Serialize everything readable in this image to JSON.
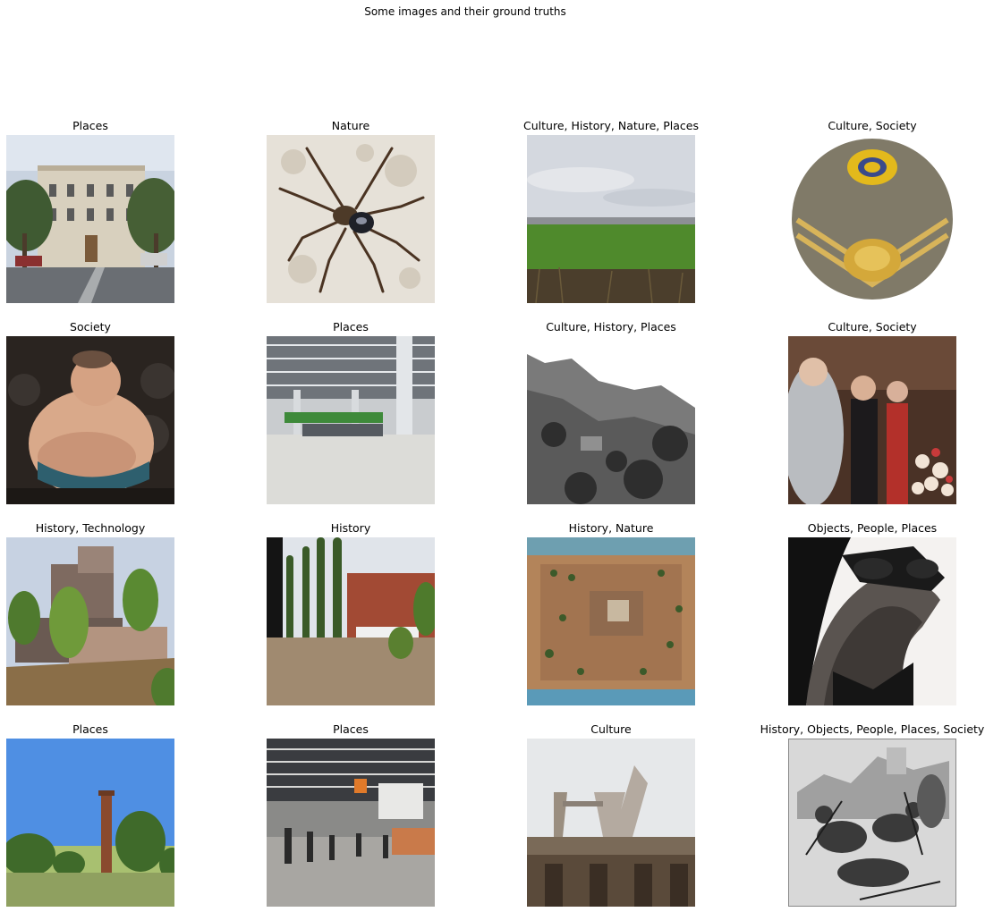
{
  "figure": {
    "suptitle": "Some images and their ground truths"
  },
  "cells": [
    {
      "label": "Places"
    },
    {
      "label": "Nature"
    },
    {
      "label": "Culture, History, Nature, Places"
    },
    {
      "label": "Culture, Society"
    },
    {
      "label": "Society"
    },
    {
      "label": "Places"
    },
    {
      "label": "Culture, History, Places"
    },
    {
      "label": "Culture, Society"
    },
    {
      "label": "History, Technology"
    },
    {
      "label": "History"
    },
    {
      "label": "History, Nature"
    },
    {
      "label": "Objects, People, Places"
    },
    {
      "label": "Places"
    },
    {
      "label": "Places"
    },
    {
      "label": "Culture"
    },
    {
      "label": "History, Objects, People, Places, Society"
    }
  ]
}
